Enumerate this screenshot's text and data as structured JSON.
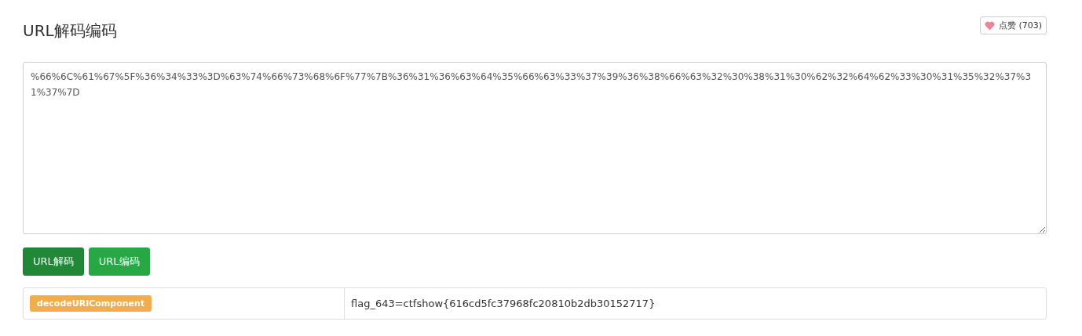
{
  "title": "URL解码编码",
  "like_button": {
    "label": "点赞 (703)"
  },
  "input": {
    "value": "%66%6C%61%67%5F%36%34%33%3D%63%74%66%73%68%6F%77%7B%36%31%36%63%64%35%66%63%33%37%39%36%38%66%63%32%30%38%31%30%62%32%64%62%33%30%31%35%32%37%31%37%7D"
  },
  "buttons": [
    {
      "label": "URL解码",
      "selected": true
    },
    {
      "label": "URL编码",
      "selected": false
    }
  ],
  "result": {
    "method": "decodeURIComponent",
    "output": "flag_643=ctfshow{616cd5fc37968fc20810b2db30152717}"
  }
}
